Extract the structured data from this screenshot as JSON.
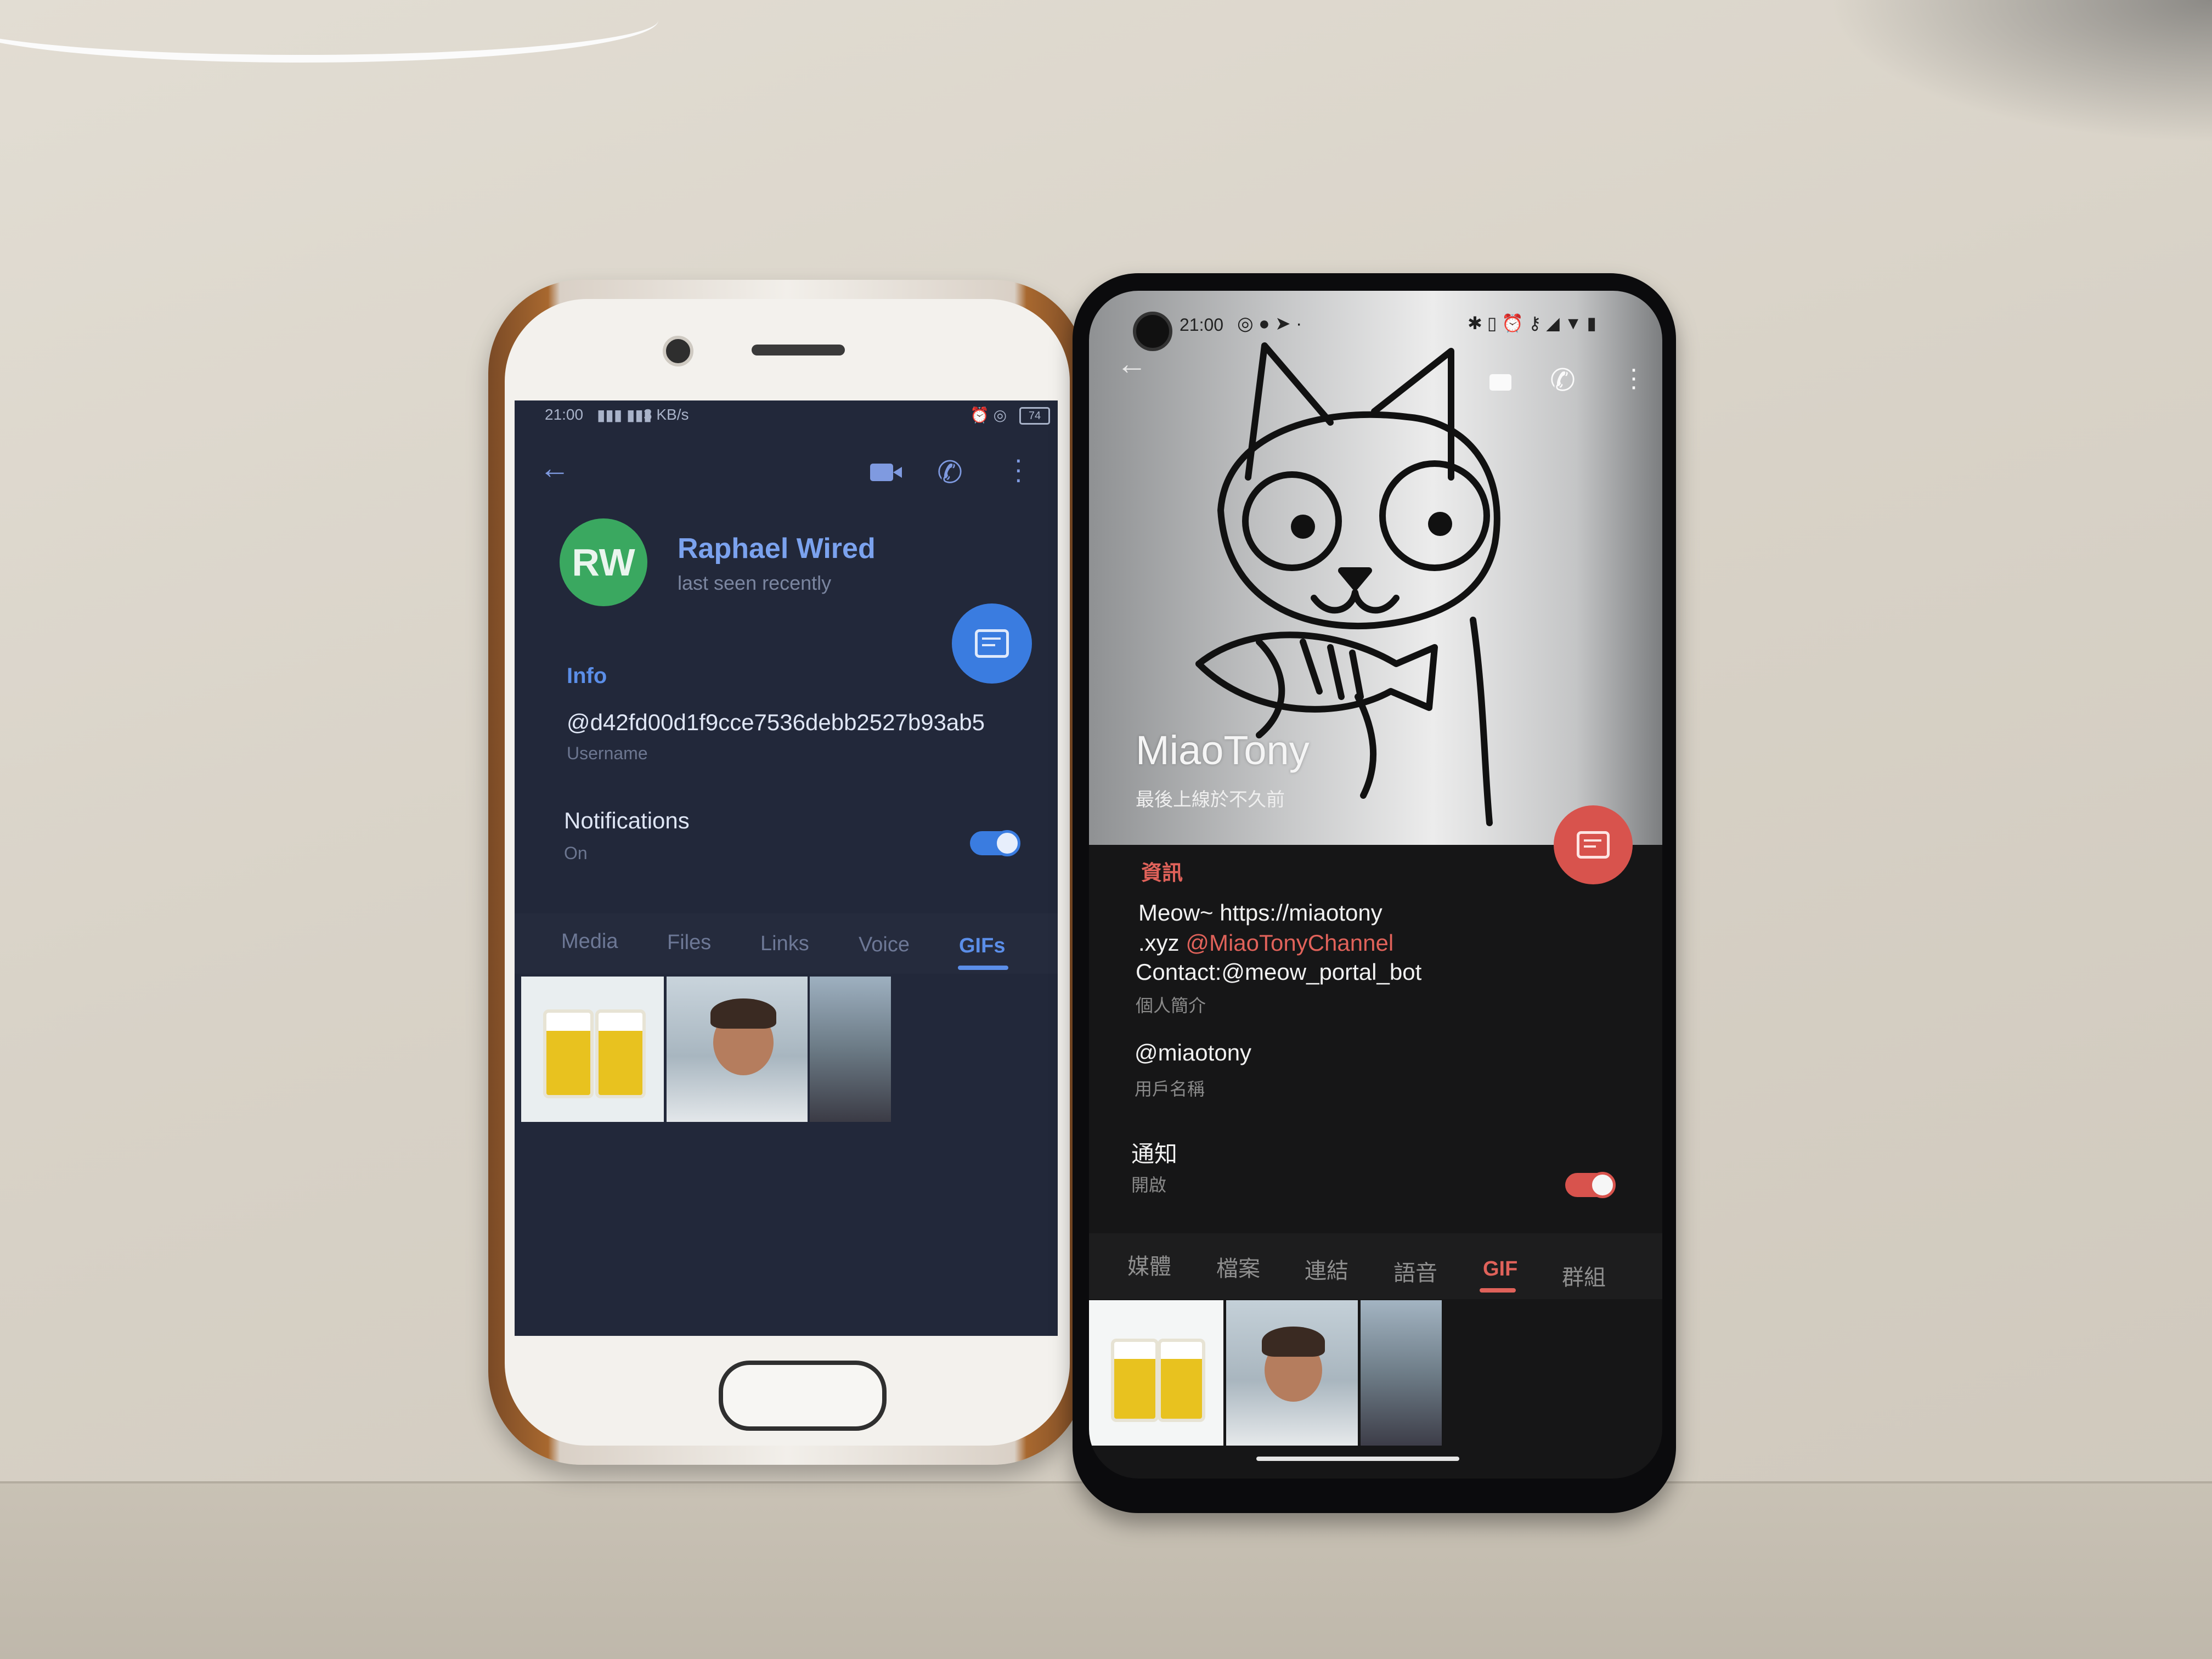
{
  "left_phone": {
    "status_bar": {
      "time": "21:00",
      "speed": "3 KB/s",
      "battery": "74"
    },
    "toolbar": {
      "back_icon": "arrow-left-icon",
      "video_icon": "video-camera-icon",
      "call_icon": "phone-icon",
      "menu_icon": "more-vert-icon"
    },
    "profile": {
      "initials": "RW",
      "name": "Raphael Wired",
      "status": "last seen recently"
    },
    "fab_icon": "message-icon",
    "info": {
      "section_title": "Info",
      "username": "@d42fd00d1f9cce7536debb2527b93ab5",
      "username_label": "Username",
      "notifications_title": "Notifications",
      "notifications_value": "On",
      "notifications_enabled": true
    },
    "tabs": [
      "Media",
      "Files",
      "Links",
      "Voice",
      "GIFs"
    ],
    "active_tab": "GIFs"
  },
  "right_phone": {
    "status_bar": {
      "time": "21:00"
    },
    "toolbar": {
      "back_icon": "arrow-left-icon",
      "video_icon": "video-camera-icon",
      "call_icon": "phone-icon",
      "menu_icon": "more-vert-icon"
    },
    "profile": {
      "name": "MiaoTony",
      "status": "最後上線於不久前"
    },
    "fab_icon": "message-icon",
    "info": {
      "section_title": "資訊",
      "bio_line1": "Meow~ https://miaotony",
      "bio_line2_prefix": ".xyz ",
      "bio_link": "@MiaoTonyChannel",
      "bio_line3": "Contact:@meow_portal_bot",
      "bio_label": "個人簡介",
      "username": "@miaotony",
      "username_label": "用戶名稱",
      "notifications_title": "通知",
      "notifications_value": "開啟",
      "notifications_enabled": true
    },
    "tabs": [
      "媒體",
      "檔案",
      "連結",
      "語音",
      "GIF",
      "群組"
    ],
    "active_tab": "GIF"
  },
  "colors": {
    "left_accent": "#5b8ee8",
    "left_bg": "#22283a",
    "right_accent": "#e0625a",
    "right_bg": "#161617"
  }
}
